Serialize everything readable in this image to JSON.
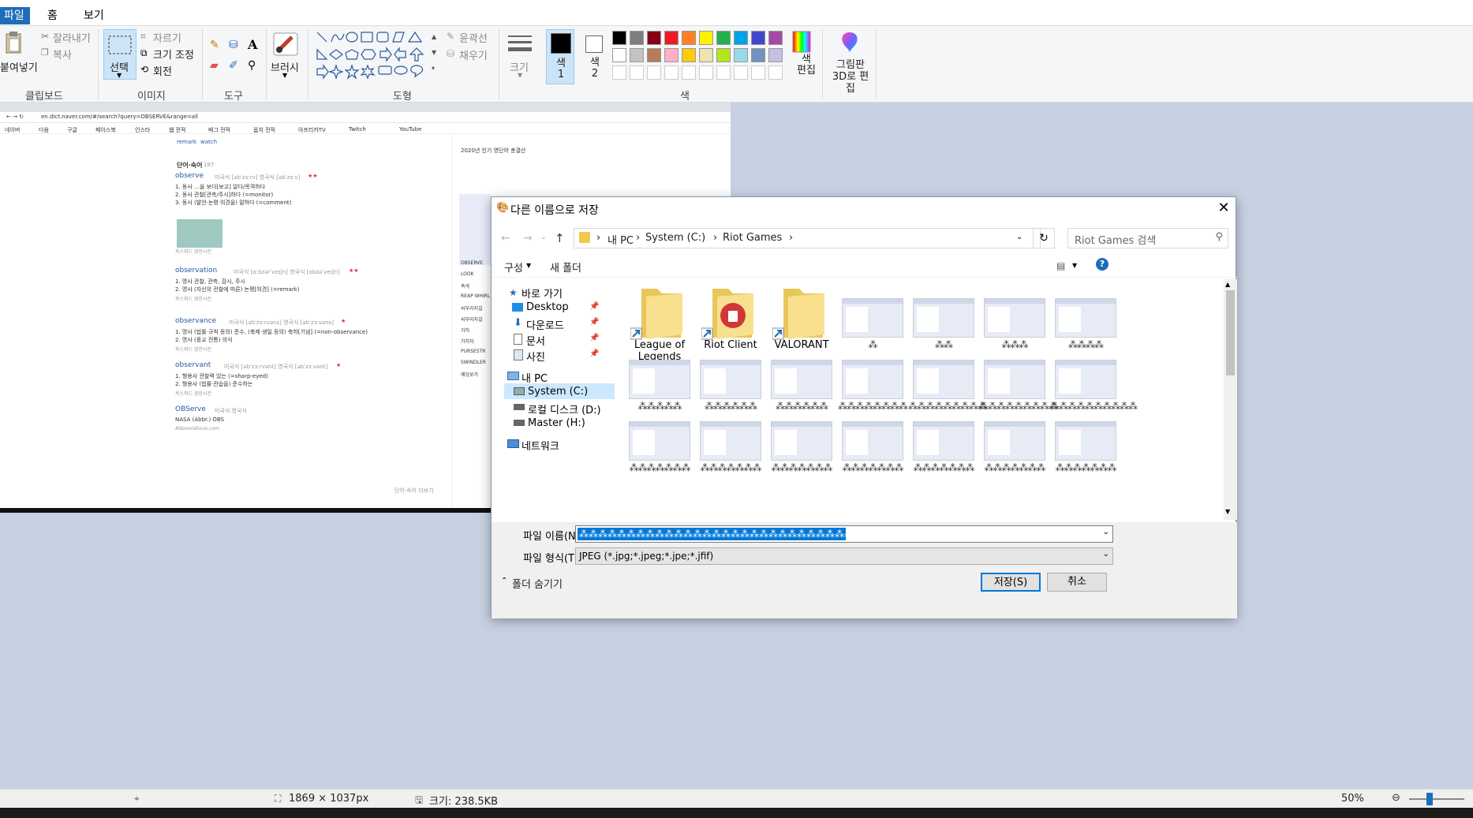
{
  "app": {
    "menu": {
      "file": "파일",
      "home": "홈",
      "view": "보기"
    }
  },
  "ribbon": {
    "clipboard": {
      "paste": "붙여넣기",
      "cut": "잘라내기",
      "copy": "복사",
      "label": "클립보드"
    },
    "image": {
      "select": "선택",
      "crop": "자르기",
      "resize": "크기 조정",
      "rotate": "회전",
      "label": "이미지"
    },
    "tools": {
      "label": "도구"
    },
    "brush": {
      "label": "브러시"
    },
    "shapes": {
      "outline": "윤곽선",
      "fill": "채우기",
      "label": "도형"
    },
    "size": {
      "label": "크기"
    },
    "colors": {
      "color1": "색\n1",
      "color2": "색\n2",
      "edit": "색\n편집",
      "label": "색",
      "row1": [
        "#000000",
        "#7f7f7f",
        "#880015",
        "#ed1c24",
        "#ff7f27",
        "#fff200",
        "#22b14c",
        "#00a2e8",
        "#3f48cc",
        "#a349a4"
      ],
      "row2": [
        "#ffffff",
        "#c3c3c3",
        "#b97a57",
        "#ffaec9",
        "#ffc90e",
        "#efe4b0",
        "#b5e61d",
        "#99d9ea",
        "#7092be",
        "#c8bfe7"
      ]
    },
    "paint3d": {
      "label": "그림판 3D로 편집"
    }
  },
  "canvas_screenshot": {
    "address": "en.dict.naver.com/#/search?query=OBSERVE&range=all",
    "bookmarks": [
      "네이버",
      "다음",
      "구글",
      "페이스북",
      "인스타",
      "웹 전적",
      "배그 전적",
      "옵치 전적",
      "아프리카TV",
      "Twitch",
      "YouTube"
    ],
    "top_words": [
      "remark",
      "watch"
    ],
    "section_title": "단어·숙어",
    "section_count": "187",
    "entries": [
      {
        "word": "observe",
        "pron": "미국식 [əbˈzɜːrv] 영국식 [əbˈzɜːv]",
        "stars": "★★",
        "defs": [
          "1. 동사 …을 보다[보고] 알다/목격하다",
          "2. 동사 관찰[관측/주시]하다 (=monitor)",
          "3. 동사 (발언·논평·의견을) 말하다 (=comment)"
        ],
        "src": "옥스퍼드 영한사전"
      },
      {
        "word": "observation",
        "pron": "미국식 [ɑːbzərˈveɪʃn] 영국식 [ɒbzəˈveɪʃn]",
        "stars": "★★",
        "defs": [
          "1. 명사 관찰, 관측, 감시, 주시",
          "2. 명사 (자신의 관찰에 따른) 논평[의견] (=remark)"
        ],
        "src": "옥스퍼드 영한사전"
      },
      {
        "word": "observance",
        "pron": "미국식 [əbˈzɜːrvəns] 영국식 [əbˈzɜːvəns]",
        "stars": "★",
        "defs": [
          "1. 명사 (법률·규칙 등의) 준수, (축제·생일 등의) 축하[기념] (=non-observance)",
          "2. 명사 (종교 전통) 의식"
        ],
        "src": "옥스퍼드 영한사전"
      },
      {
        "word": "observant",
        "pron": "미국식 [əbˈzɜːrvənt] 영국식 [əbˈzɜːvənt]",
        "stars": "★",
        "defs": [
          "1. 형용사 관찰력 있는 (=sharp-eyed)",
          "2. 형용사 (법률·관습을) 준수하는"
        ],
        "src": "옥스퍼드 영한사전"
      },
      {
        "word": "OBServe",
        "pron": "미국식 영국식",
        "stars": "",
        "defs": [
          "NASA (Abbr.) OBS"
        ],
        "src": "Abbreviations.com"
      }
    ],
    "more_link": "단어·숙어 더보기",
    "side_text": "2020년 인기 영단어 총결산",
    "side_list": [
      "OBSERVE",
      "LOOK",
      "측색",
      "REAP WHIRL",
      "씨부리지길",
      "씨부리지길",
      "가히",
      "가히자",
      "PURSESTR",
      "SWINDLER",
      "애잉보가"
    ]
  },
  "dialog": {
    "title": "다른 이름으로 저장",
    "breadcrumb": [
      "내 PC",
      "System (C:)",
      "Riot Games"
    ],
    "search_placeholder": "Riot Games 검색",
    "organize": "구성",
    "new_folder": "새 폴더",
    "nav": {
      "quick_access": "바로 가기",
      "desktop": "Desktop",
      "downloads": "다운로드",
      "documents": "문서",
      "pictures": "사진",
      "this_pc": "내 PC",
      "system_c": "System (C:)",
      "local_d": "로컬 디스크 (D:)",
      "master_h": "Master (H:)",
      "network": "네트워크"
    },
    "folders": [
      "League of Legends",
      "Riot Client",
      "VALORANT"
    ],
    "thumb_names": [
      "⁂",
      "⁂⁂",
      "⁂⁂⁂",
      "⁂⁂⁂⁂",
      "⁂⁂⁂⁂⁂",
      "⁂⁂⁂⁂⁂⁂",
      "⁂⁂⁂⁂⁂⁂",
      "⁂⁂⁂⁂⁂⁂⁂⁂",
      "⁂⁂⁂⁂⁂⁂⁂⁂⁂",
      "⁂⁂⁂⁂⁂⁂⁂⁂⁂",
      "⁂⁂⁂⁂⁂⁂⁂⁂⁂⁂",
      "⁂⁂⁂⁂⁂⁂⁂",
      "⁂⁂⁂⁂⁂⁂⁂",
      "⁂⁂⁂⁂⁂⁂⁂",
      "⁂⁂⁂⁂⁂⁂⁂",
      "⁂⁂⁂⁂⁂⁂⁂",
      "⁂⁂⁂⁂⁂⁂⁂",
      "⁂⁂⁂⁂⁂⁂⁂"
    ],
    "filename_label": "파일 이름(N):",
    "filename_value": "⁂⁂⁂⁂⁂⁂⁂⁂⁂⁂⁂⁂⁂⁂⁂⁂⁂⁂⁂⁂⁂⁂⁂⁂⁂⁂⁂⁂⁂⁂⁂⁂⁂⁂⁂⁂",
    "filetype_label": "파일 형식(T):",
    "filetype_value": "JPEG (*.jpg;*.jpeg;*.jpe;*.jfif)",
    "hide_folders": "폴더 숨기기",
    "save": "저장(S)",
    "cancel": "취소"
  },
  "status": {
    "dimensions": "1869 × 1037px",
    "size": "크기: 238.5KB",
    "zoom": "50%"
  }
}
